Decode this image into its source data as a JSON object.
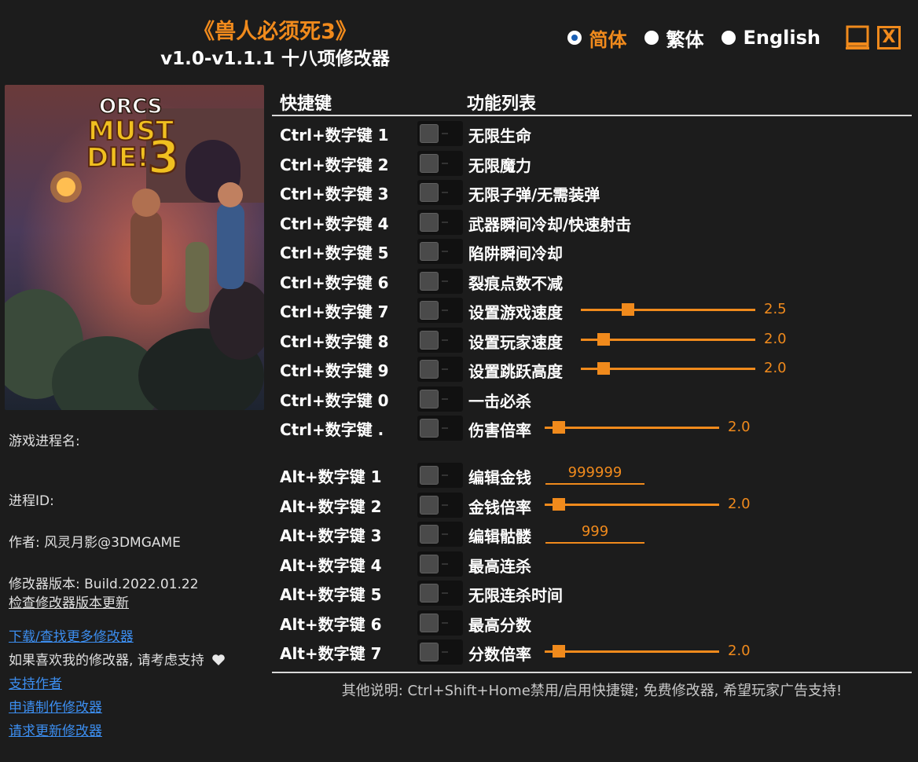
{
  "header": {
    "title": "《兽人必须死3》",
    "subtitle": "v1.0-v1.1.1 十八项修改器"
  },
  "languages": [
    {
      "label": "简体",
      "selected": true
    },
    {
      "label": "繁体",
      "selected": false
    },
    {
      "label": "English",
      "selected": false
    }
  ],
  "window_buttons": {
    "minimize": "minimize-icon",
    "close_label": "X"
  },
  "cover": {
    "logo_line1": "ORCS",
    "logo_line2": "MUST",
    "logo_line3": "DIE!",
    "logo_number": "3"
  },
  "info": {
    "process_name_label": "游戏进程名:",
    "process_id_label": "进程ID:",
    "author": "作者: 风灵月影@3DMGAME",
    "version": "修改器版本: Build.2022.01.22",
    "check_update": "检查修改器版本更新",
    "download_more": "下载/查找更多修改器",
    "support_text": "如果喜欢我的修改器, 请考虑支持",
    "support_author": "支持作者",
    "request_trainer": "申请制作修改器",
    "request_update": "请求更新修改器"
  },
  "table": {
    "col_hotkey": "快捷键",
    "col_features": "功能列表"
  },
  "rows": [
    {
      "hotkey": "Ctrl+数字键 1",
      "feature": "无限生命"
    },
    {
      "hotkey": "Ctrl+数字键 2",
      "feature": "无限魔力"
    },
    {
      "hotkey": "Ctrl+数字键 3",
      "feature": "无限子弹/无需装弹"
    },
    {
      "hotkey": "Ctrl+数字键 4",
      "feature": "武器瞬间冷却/快速射击"
    },
    {
      "hotkey": "Ctrl+数字键 5",
      "feature": "陷阱瞬间冷却"
    },
    {
      "hotkey": "Ctrl+数字键 6",
      "feature": "裂痕点数不减"
    },
    {
      "hotkey": "Ctrl+数字键 7",
      "feature": "设置游戏速度",
      "slider": "2.5",
      "slider_fraction": 0.25
    },
    {
      "hotkey": "Ctrl+数字键 8",
      "feature": "设置玩家速度",
      "slider": "2.0",
      "slider_fraction": 0.1
    },
    {
      "hotkey": "Ctrl+数字键 9",
      "feature": "设置跳跃高度",
      "slider": "2.0",
      "slider_fraction": 0.1
    },
    {
      "hotkey": "Ctrl+数字键 0",
      "feature": "一击必杀"
    },
    {
      "hotkey": "Ctrl+数字键 .",
      "feature": "伤害倍率",
      "slider": "2.0",
      "slider_fraction": 0.05
    },
    {
      "hotkey": "Alt+数字键 1",
      "feature": "编辑金钱",
      "edit": "999999"
    },
    {
      "hotkey": "Alt+数字键 2",
      "feature": "金钱倍率",
      "slider": "2.0",
      "slider_fraction": 0.05
    },
    {
      "hotkey": "Alt+数字键 3",
      "feature": "编辑骷髅",
      "edit": "999"
    },
    {
      "hotkey": "Alt+数字键 4",
      "feature": "最高连杀"
    },
    {
      "hotkey": "Alt+数字键 5",
      "feature": "无限连杀时间"
    },
    {
      "hotkey": "Alt+数字键 6",
      "feature": "最高分数"
    },
    {
      "hotkey": "Alt+数字键 7",
      "feature": "分数倍率",
      "slider": "2.0",
      "slider_fraction": 0.05
    }
  ],
  "footer_note": "其他说明: Ctrl+Shift+Home禁用/启用快捷键; 免费修改器, 希望玩家广告支持!"
}
